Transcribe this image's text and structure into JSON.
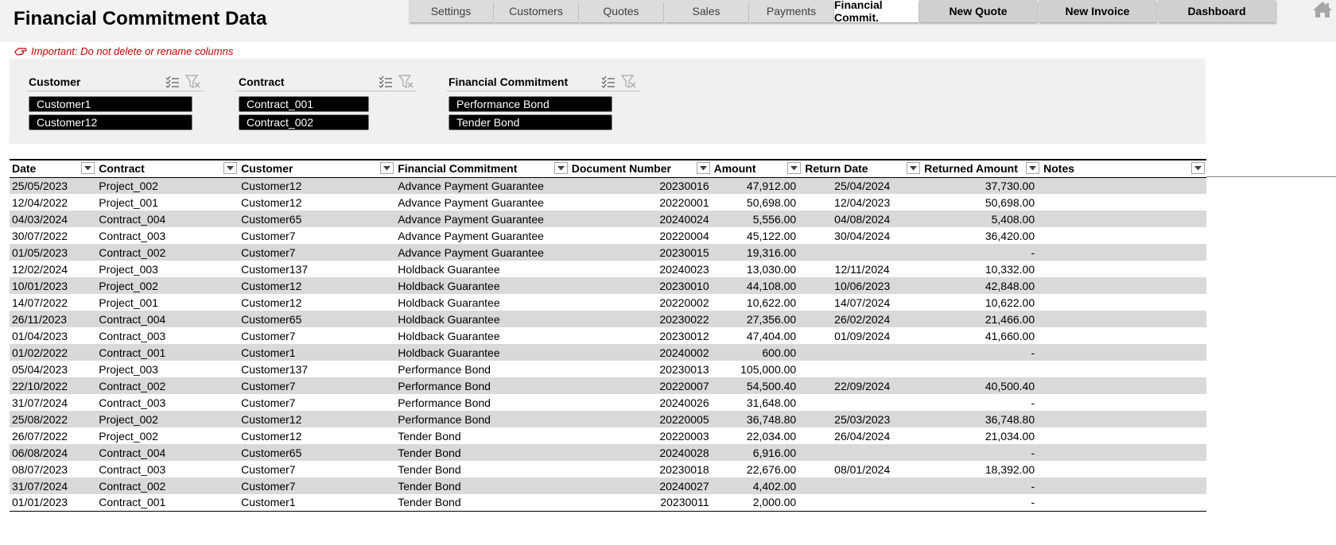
{
  "header": {
    "title": "Financial Commitment Data",
    "tabs": [
      "Settings",
      "Customers",
      "Quotes",
      "Sales",
      "Payments",
      "Financial Commit."
    ],
    "active_tab": "Financial Commit.",
    "actions": [
      "New Quote",
      "New Invoice",
      "Dashboard"
    ],
    "home_icon": "home-icon"
  },
  "warning": {
    "text": "Important: Do not delete or rename columns",
    "icon": "pointing-hand-icon",
    "color": "#c00000"
  },
  "slicers": [
    {
      "title": "Customer",
      "items": [
        "Customer1",
        "Customer12"
      ]
    },
    {
      "title": "Contract",
      "items": [
        "Contract_001",
        "Contract_002"
      ]
    },
    {
      "title": "Financial Commitment",
      "items": [
        "Performance Bond",
        "Tender Bond"
      ]
    }
  ],
  "table": {
    "columns": [
      "Date",
      "Contract",
      "Customer",
      "Financial Commitment",
      "Document Number",
      "Amount",
      "Return Date",
      "Returned Amount",
      "Notes"
    ],
    "rows": [
      [
        "25/05/2023",
        "Project_002",
        "Customer12",
        "Advance Payment Guarantee",
        "20230016",
        "47,912.00",
        "25/04/2024",
        "37,730.00",
        ""
      ],
      [
        "12/04/2022",
        "Project_001",
        "Customer12",
        "Advance Payment Guarantee",
        "20220001",
        "50,698.00",
        "12/04/2023",
        "50,698.00",
        ""
      ],
      [
        "04/03/2024",
        "Contract_004",
        "Customer65",
        "Advance Payment Guarantee",
        "20240024",
        "5,556.00",
        "04/08/2024",
        "5,408.00",
        ""
      ],
      [
        "30/07/2022",
        "Contract_003",
        "Customer7",
        "Advance Payment Guarantee",
        "20220004",
        "45,122.00",
        "30/04/2024",
        "36,420.00",
        ""
      ],
      [
        "01/05/2023",
        "Contract_002",
        "Customer7",
        "Advance Payment Guarantee",
        "20230015",
        "19,316.00",
        "",
        "-",
        ""
      ],
      [
        "12/02/2024",
        "Project_003",
        "Customer137",
        "Holdback Guarantee",
        "20240023",
        "13,030.00",
        "12/11/2024",
        "10,332.00",
        ""
      ],
      [
        "10/01/2023",
        "Project_002",
        "Customer12",
        "Holdback Guarantee",
        "20230010",
        "44,108.00",
        "10/06/2023",
        "42,848.00",
        ""
      ],
      [
        "14/07/2022",
        "Project_001",
        "Customer12",
        "Holdback Guarantee",
        "20220002",
        "10,622.00",
        "14/07/2024",
        "10,622.00",
        ""
      ],
      [
        "26/11/2023",
        "Contract_004",
        "Customer65",
        "Holdback Guarantee",
        "20230022",
        "27,356.00",
        "26/02/2024",
        "21,466.00",
        ""
      ],
      [
        "01/04/2023",
        "Contract_003",
        "Customer7",
        "Holdback Guarantee",
        "20230012",
        "47,404.00",
        "01/09/2024",
        "41,660.00",
        ""
      ],
      [
        "01/02/2022",
        "Contract_001",
        "Customer1",
        "Holdback Guarantee",
        "20240002",
        "600.00",
        "",
        "-",
        ""
      ],
      [
        "05/04/2023",
        "Project_003",
        "Customer137",
        "Performance Bond",
        "20230013",
        "105,000.00",
        "",
        "",
        ""
      ],
      [
        "22/10/2022",
        "Contract_002",
        "Customer7",
        "Performance Bond",
        "20220007",
        "54,500.40",
        "22/09/2024",
        "40,500.40",
        ""
      ],
      [
        "31/07/2024",
        "Contract_003",
        "Customer7",
        "Performance Bond",
        "20240026",
        "31,648.00",
        "",
        "-",
        ""
      ],
      [
        "25/08/2022",
        "Project_002",
        "Customer12",
        "Performance Bond",
        "20220005",
        "36,748.80",
        "25/03/2023",
        "36,748.80",
        ""
      ],
      [
        "26/07/2022",
        "Project_002",
        "Customer12",
        "Tender Bond",
        "20220003",
        "22,034.00",
        "26/04/2024",
        "21,034.00",
        ""
      ],
      [
        "06/08/2024",
        "Contract_004",
        "Customer65",
        "Tender Bond",
        "20240028",
        "6,916.00",
        "",
        "-",
        ""
      ],
      [
        "08/07/2023",
        "Contract_003",
        "Customer7",
        "Tender Bond",
        "20230018",
        "22,676.00",
        "08/01/2024",
        "18,392.00",
        ""
      ],
      [
        "31/07/2024",
        "Contract_002",
        "Customer7",
        "Tender Bond",
        "20240027",
        "4,402.00",
        "",
        "-",
        ""
      ],
      [
        "01/01/2023",
        "Contract_001",
        "Customer1",
        "Tender Bond",
        "20230011",
        "2,000.00",
        "",
        "-",
        ""
      ]
    ]
  }
}
